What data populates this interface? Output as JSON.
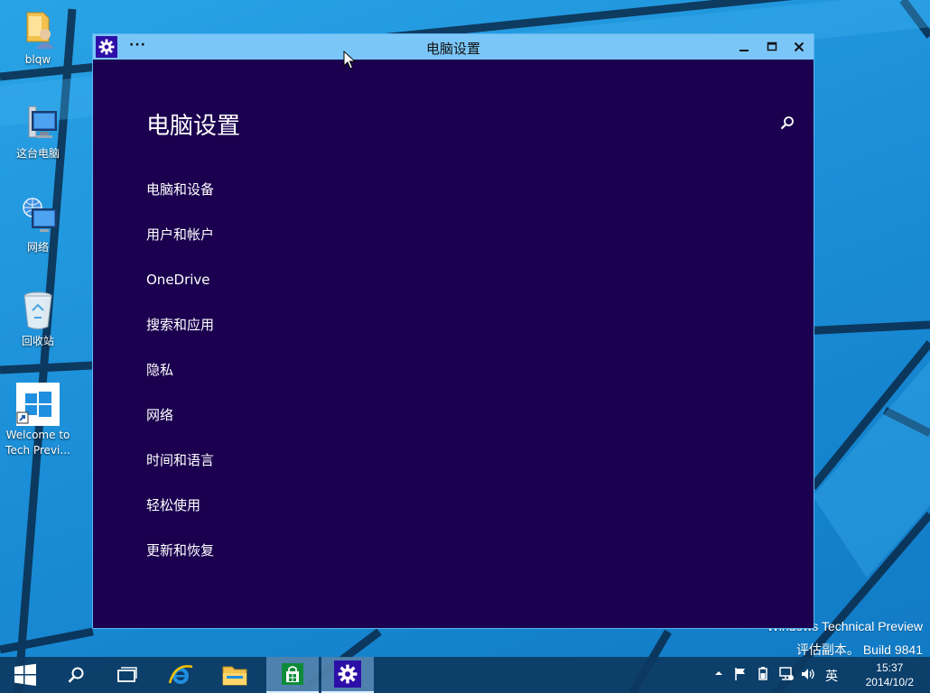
{
  "desktop": {
    "icons": [
      {
        "label": "blqw",
        "icon": "user-folder-icon"
      },
      {
        "label": "这台电脑",
        "icon": "computer-icon"
      },
      {
        "label": "网络",
        "icon": "network-icon"
      },
      {
        "label": "回收站",
        "icon": "recycle-bin-icon"
      },
      {
        "label_line1": "Welcome to",
        "label_line2": "Tech Previ...",
        "icon": "windows-shortcut-icon"
      }
    ],
    "watermark": {
      "line1": "Windows Technical Preview",
      "line2": "评估副本。 Build 9841"
    }
  },
  "window": {
    "title": "电脑设置",
    "menu_dots": "···",
    "page_title": "电脑设置",
    "menu_items": [
      {
        "label": "电脑和设备"
      },
      {
        "label": "用户和帐户"
      },
      {
        "label": "OneDrive"
      },
      {
        "label": "搜索和应用"
      },
      {
        "label": "隐私"
      },
      {
        "label": "网络"
      },
      {
        "label": "时间和语言"
      },
      {
        "label": "轻松使用"
      },
      {
        "label": "更新和恢复"
      }
    ]
  },
  "taskbar": {
    "buttons": [
      "start-icon",
      "search-icon",
      "task-view-icon",
      "internet-explorer-icon",
      "file-explorer-icon",
      "store-icon",
      "settings-icon"
    ],
    "tray": {
      "ime": "英",
      "time": "15:37",
      "date": "2014/10/2"
    }
  },
  "colors": {
    "window_bg": "#1b004f",
    "titlebar": "#7bc6f8",
    "accent": "#2d0fa8",
    "desktop": "#1a8ad4"
  }
}
